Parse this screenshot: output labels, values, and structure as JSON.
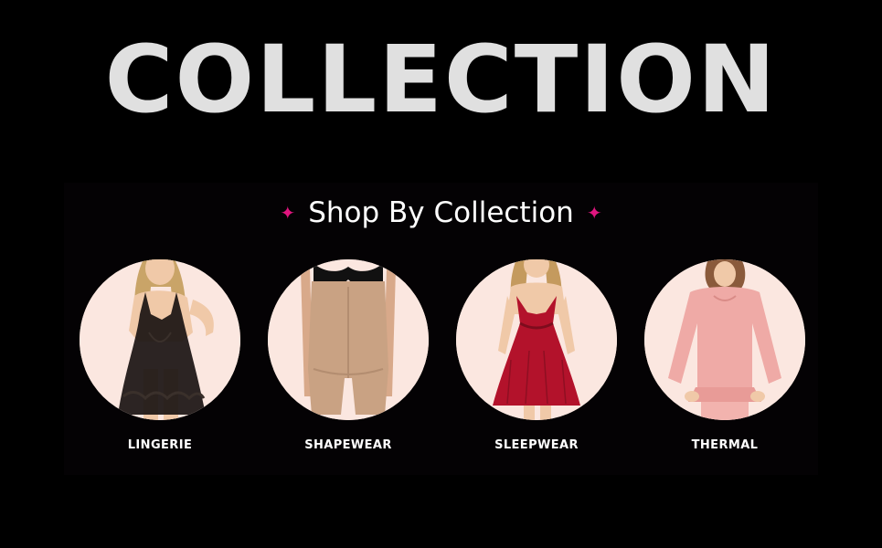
{
  "hero": {
    "title": "COLLECTION"
  },
  "section": {
    "title": "Shop By Collection",
    "accent_color": "#e0157f",
    "decor_icon": "sparkle-icon"
  },
  "collections": [
    {
      "label": "LINGERIE",
      "image": "black lace babydoll lingerie on model",
      "bg_color": "#fbe7e0"
    },
    {
      "label": "SHAPEWEAR",
      "image": "beige high-waist shapewear with black bra",
      "bg_color": "#fbe7e0"
    },
    {
      "label": "SLEEPWEAR",
      "image": "red lace babydoll sleepwear on model",
      "bg_color": "#fbe7e0"
    },
    {
      "label": "THERMAL",
      "image": "pink long-sleeve thermal top on model",
      "bg_color": "#fbe7e0"
    }
  ]
}
